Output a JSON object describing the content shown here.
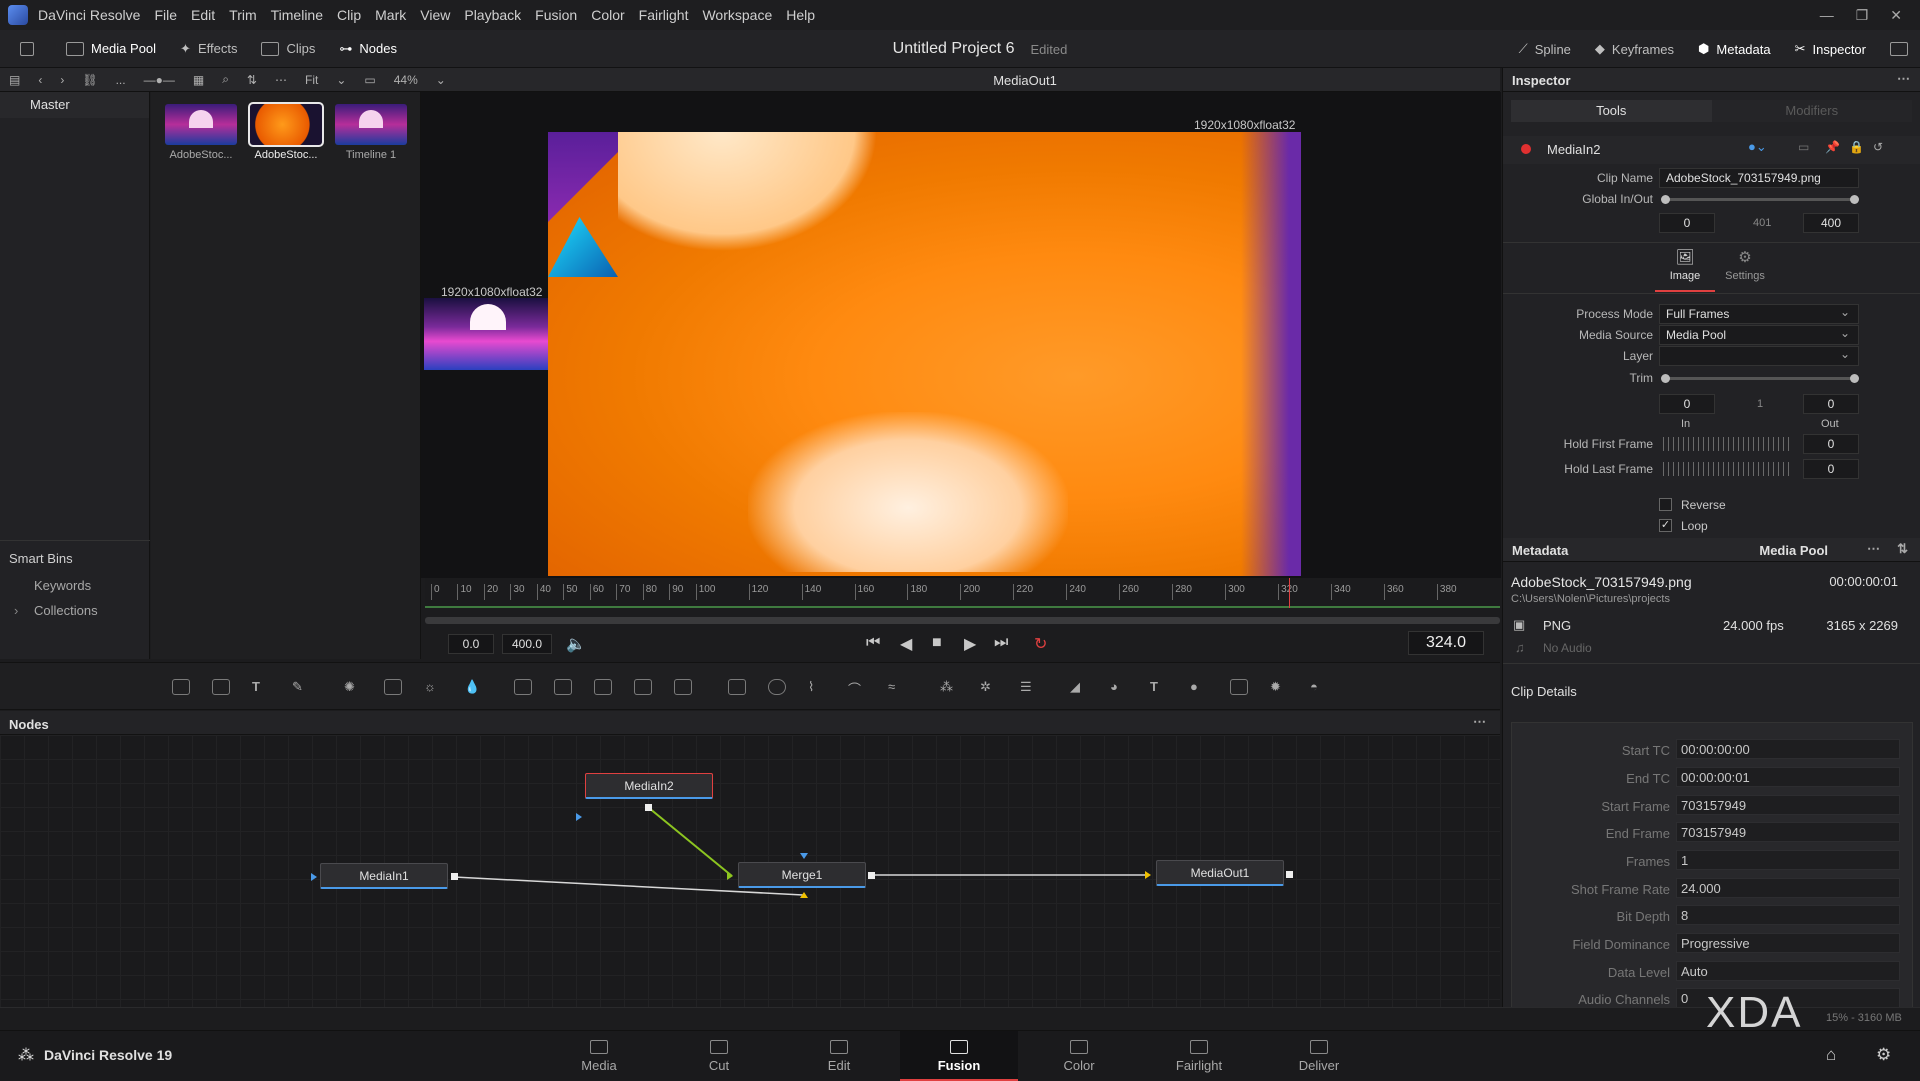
{
  "menubar": {
    "app": "DaVinci Resolve",
    "items": [
      "File",
      "Edit",
      "Trim",
      "Timeline",
      "Clip",
      "Mark",
      "View",
      "Playback",
      "Fusion",
      "Color",
      "Fairlight",
      "Workspace",
      "Help"
    ]
  },
  "toolbar": {
    "media_pool": "Media Pool",
    "effects": "Effects",
    "clips": "Clips",
    "nodes": "Nodes",
    "project_title": "Untitled Project 6",
    "project_status": "Edited",
    "spline": "Spline",
    "keyframes": "Keyframes",
    "metadata": "Metadata",
    "inspector": "Inspector"
  },
  "subbar": {
    "more": "...",
    "fit": "Fit",
    "zoom": "44%",
    "viewer_title": "MediaOut1"
  },
  "bins": {
    "master": "Master",
    "smart_bins": "Smart Bins",
    "keywords": "Keywords",
    "collections": "Collections"
  },
  "clips": [
    {
      "label": "AdobeStoc...",
      "type": "synth"
    },
    {
      "label": "AdobeStoc...",
      "type": "fish",
      "selected": true
    },
    {
      "label": "Timeline 1",
      "type": "synth"
    }
  ],
  "viewer": {
    "res_main": "1920x1080xfloat32",
    "res_thumb": "1920x1080xfloat32",
    "ruler_ticks": [
      "0",
      "10",
      "20",
      "30",
      "40",
      "50",
      "60",
      "70",
      "80",
      "90",
      "100",
      "120",
      "140",
      "160",
      "180",
      "200",
      "220",
      "240",
      "260",
      "280",
      "300",
      "320",
      "340",
      "360",
      "380"
    ],
    "in_time": "0.0",
    "out_time": "400.0",
    "current_frame": "324.0"
  },
  "nodes": {
    "title": "Nodes",
    "media_in2": "MediaIn2",
    "media_in1": "MediaIn1",
    "merge1": "Merge1",
    "media_out1": "MediaOut1"
  },
  "inspector": {
    "title": "Inspector",
    "tab_tools": "Tools",
    "tab_modifiers": "Modifiers",
    "tool_name": "MediaIn2",
    "clip_name_label": "Clip Name",
    "clip_name": "AdobeStock_703157949.png",
    "global_inout_label": "Global In/Out",
    "global_in": "0",
    "global_mid": "401",
    "global_out": "400",
    "subtab_image": "Image",
    "subtab_settings": "Settings",
    "process_mode_label": "Process Mode",
    "process_mode": "Full Frames",
    "media_source_label": "Media Source",
    "media_source": "Media Pool",
    "layer_label": "Layer",
    "layer": "",
    "trim_label": "Trim",
    "trim_in": "0",
    "trim_mid": "1",
    "trim_out": "0",
    "in_label": "In",
    "out_label": "Out",
    "hold_first_label": "Hold First Frame",
    "hold_first": "0",
    "hold_last_label": "Hold Last Frame",
    "hold_last": "0",
    "reverse_label": "Reverse",
    "loop_label": "Loop"
  },
  "metadata": {
    "title": "Metadata",
    "source": "Media Pool",
    "file_name": "AdobeStock_703157949.png",
    "duration": "00:00:00:01",
    "path": "C:\\Users\\Nolen\\Pictures\\projects",
    "format": "PNG",
    "fps": "24.000 fps",
    "resolution": "3165 x 2269",
    "audio": "No Audio",
    "clip_details": "Clip Details",
    "details": [
      {
        "label": "Start TC",
        "value": "00:00:00:00"
      },
      {
        "label": "End TC",
        "value": "00:00:00:01"
      },
      {
        "label": "Start Frame",
        "value": "703157949"
      },
      {
        "label": "End Frame",
        "value": "703157949"
      },
      {
        "label": "Frames",
        "value": "1"
      },
      {
        "label": "Shot Frame Rate",
        "value": "24.000"
      },
      {
        "label": "Bit Depth",
        "value": "8"
      },
      {
        "label": "Field Dominance",
        "value": "Progressive"
      },
      {
        "label": "Data Level",
        "value": "Auto"
      },
      {
        "label": "Audio Channels",
        "value": "0"
      }
    ]
  },
  "pages": {
    "brand": "DaVinci Resolve 19",
    "items": [
      "Media",
      "Cut",
      "Edit",
      "Fusion",
      "Color",
      "Fairlight",
      "Deliver"
    ],
    "active": "Fusion"
  },
  "watermark": "XDA",
  "memory": "15% - 3160 MB"
}
